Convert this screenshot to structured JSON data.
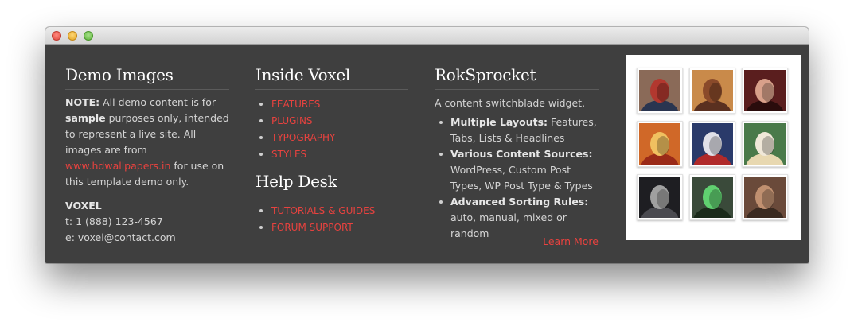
{
  "demo": {
    "title": "Demo Images",
    "note_label": "NOTE:",
    "note_text_1": " All demo content is for ",
    "sample_word": "sample",
    "note_text_2": " purposes only, intended to represent a live site. All images are from ",
    "link_text": "www.hdwallpapers.in",
    "note_text_3": " for use on this template demo only.",
    "brand": "VOXEL",
    "phone": "t: 1 (888) 123-4567",
    "email": "e: voxel@contact.com"
  },
  "inside": {
    "title": "Inside Voxel",
    "links": [
      "FEATURES",
      "PLUGINS",
      "TYPOGRAPHY",
      "STYLES"
    ]
  },
  "helpdesk": {
    "title": "Help Desk",
    "links": [
      "TUTORIALS & GUIDES",
      "FORUM SUPPORT"
    ]
  },
  "roksprocket": {
    "title": "RokSprocket",
    "tagline": "A content switchblade widget.",
    "features": [
      {
        "bold": "Multiple Layouts:",
        "text": " Features, Tabs, Lists & Headlines"
      },
      {
        "bold": "Various Content Sources:",
        "text": " WordPress, Custom Post Types, WP Post Type & Types"
      },
      {
        "bold": "Advanced Sorting Rules:",
        "text": " auto, manual, mixed or random"
      }
    ],
    "learn_more": "Learn More"
  },
  "gallery": {
    "thumbs": [
      {
        "name": "spider-man-portrait",
        "bg": "#8a6a58",
        "fg": "#2a3550",
        "accent": "#b2382f"
      },
      {
        "name": "warrior-portrait",
        "bg": "#c98a4a",
        "fg": "#5a3020",
        "accent": "#8a4a2a"
      },
      {
        "name": "woman-portrait",
        "bg": "#5a1e1e",
        "fg": "#2a0c0c",
        "accent": "#d8a08a"
      },
      {
        "name": "masked-ninja-portrait",
        "bg": "#d06828",
        "fg": "#9a2a18",
        "accent": "#f0c060"
      },
      {
        "name": "spider-man-mask-portrait",
        "bg": "#2a3a6a",
        "fg": "#b02a2a",
        "accent": "#e0e0e8"
      },
      {
        "name": "blonde-girl-portrait",
        "bg": "#4a7a4a",
        "fg": "#e8d8b0",
        "accent": "#f0e8d8"
      },
      {
        "name": "hooded-man-portrait",
        "bg": "#1e1e22",
        "fg": "#4a4a50",
        "accent": "#a0a0a0"
      },
      {
        "name": "soldier-goggles-portrait",
        "bg": "#3a4a3a",
        "fg": "#1a2a1a",
        "accent": "#60d070"
      },
      {
        "name": "adventurer-portrait",
        "bg": "#6a4a3a",
        "fg": "#3a2a20",
        "accent": "#c09070"
      }
    ]
  },
  "colors": {
    "accent": "#e8423f",
    "panel_bg": "#3f3f3f",
    "text": "#d4d4d4"
  }
}
